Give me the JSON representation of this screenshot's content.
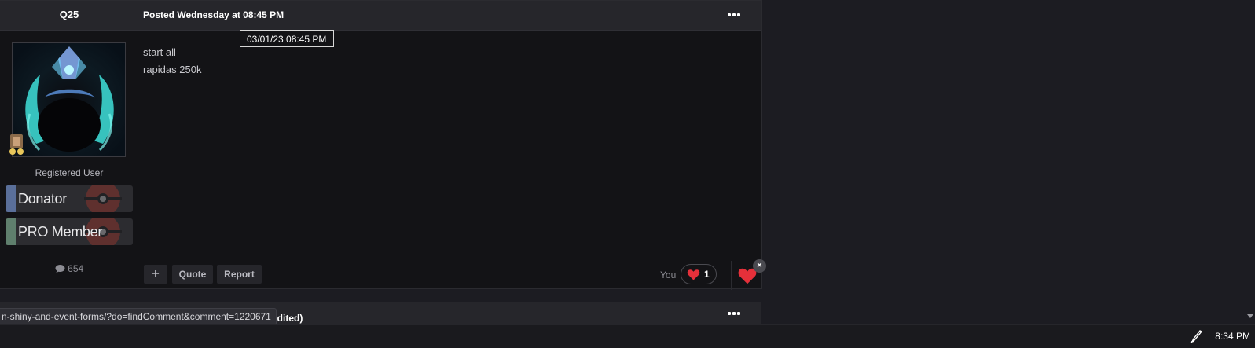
{
  "post": {
    "author": "Q25",
    "posted": "Posted Wednesday at 08:45 PM",
    "timestamp_tooltip": "03/01/23 08:45  PM",
    "body_lines": [
      "start all",
      "rapidas 250k"
    ],
    "user_title": "Registered User",
    "badges": [
      {
        "label": "Donator",
        "stripe_color": "#5a6f9a"
      },
      {
        "label": "PRO Member",
        "stripe_color": "#5f7f6d"
      }
    ],
    "post_count": "654",
    "actions": {
      "add": "+",
      "quote": "Quote",
      "report": "Report"
    },
    "reactions": {
      "by": "You",
      "count": "1"
    },
    "remove_label": "×"
  },
  "next_post": {
    "edited_fragment": "edited)"
  },
  "status_url": "n-shiny-and-event-forms/?do=findComment&comment=1220671",
  "taskbar": {
    "time": "8:34 PM"
  },
  "colors": {
    "heart": "#e5303a",
    "background": "#1c1c22",
    "post_bg": "#131316"
  }
}
